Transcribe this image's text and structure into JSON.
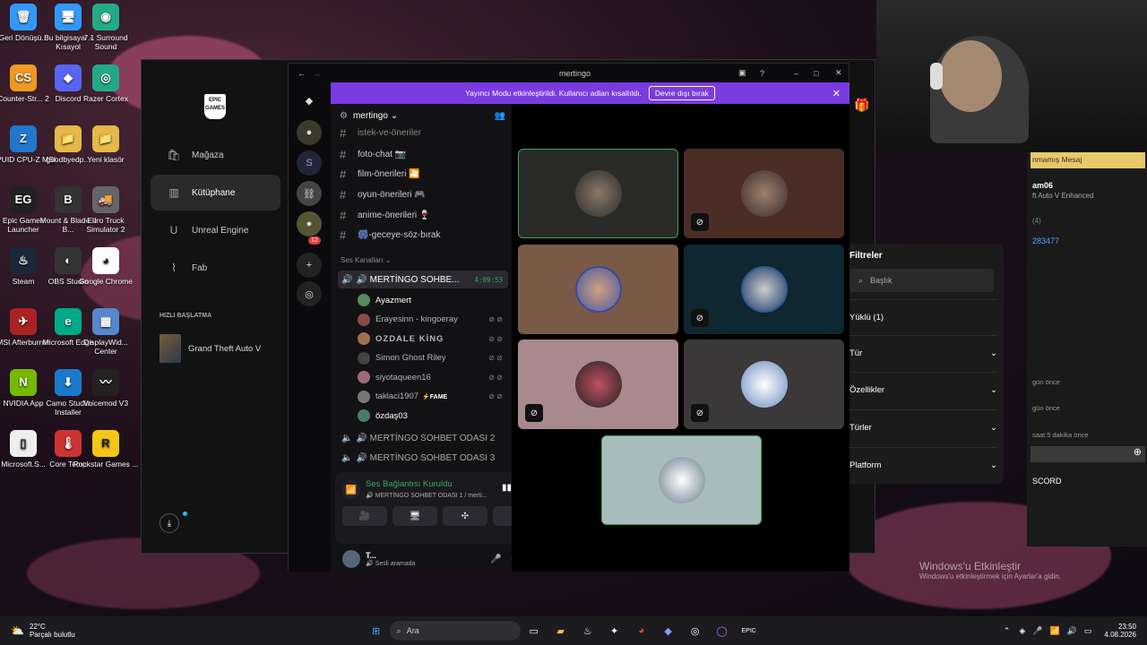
{
  "desktop": {
    "icons": [
      {
        "label": "Geri Dönüşü...",
        "glyph": "🗑"
      },
      {
        "label": "Bu bilgisayar - Kısayol",
        "glyph": "🖥"
      },
      {
        "label": "7.1 Surround Sound",
        "glyph": "◉"
      },
      {
        "label": "Counter-Str... 2",
        "glyph": "CS"
      },
      {
        "label": "Discord",
        "glyph": "◆"
      },
      {
        "label": "Razer Cortex",
        "glyph": "◎"
      },
      {
        "label": "CPUID CPU-Z MSI",
        "glyph": "Z"
      },
      {
        "label": "goodbyedp...",
        "glyph": "📁"
      },
      {
        "label": "Yeni klasör",
        "glyph": "📁"
      },
      {
        "label": "Epic Games Launcher",
        "glyph": "EG"
      },
      {
        "label": "Mount & Blade II B...",
        "glyph": "B"
      },
      {
        "label": "Euro Truck Simulator 2",
        "glyph": "🚚"
      },
      {
        "label": "Steam",
        "glyph": "♨"
      },
      {
        "label": "OBS Studio",
        "glyph": "◐"
      },
      {
        "label": "Google Chrome",
        "glyph": "◕"
      },
      {
        "label": "MSI Afterburner",
        "glyph": "✈"
      },
      {
        "label": "Microsoft Edge",
        "glyph": "e"
      },
      {
        "label": "DisplayWid... Center",
        "glyph": "▦"
      },
      {
        "label": "NVIDIA App",
        "glyph": "N"
      },
      {
        "label": "Camo Studio Installer",
        "glyph": "⬇"
      },
      {
        "label": "Voicemod V3",
        "glyph": "〰"
      },
      {
        "label": "Microsoft.S...",
        "glyph": "▯"
      },
      {
        "label": "Core Temp",
        "glyph": "🌡"
      },
      {
        "label": "Rockstar Games ...",
        "glyph": "R"
      }
    ],
    "watermark_title": "Windows'u Etkinleştir",
    "watermark_sub": "Windows'u etkinleştirmek için Ayarlar'a gidin."
  },
  "epic": {
    "logo": "EPIC GAMES",
    "nav": [
      {
        "label": "Mağaza",
        "glyph": "🛍"
      },
      {
        "label": "Kütüphane",
        "glyph": "▥"
      },
      {
        "label": "Unreal Engine",
        "glyph": "U"
      },
      {
        "label": "Fab",
        "glyph": "⌇"
      }
    ],
    "quick_title": "HIZLI BAŞLATMA",
    "quick_game": "Grand Theft Auto V",
    "filters_title": "Filtreler",
    "search_placeholder": "Başlık",
    "installed": "Yüklü (1)",
    "filter_rows": [
      "Tür",
      "Özellikler",
      "Türler",
      "Platform"
    ]
  },
  "discord": {
    "title": "mertingo",
    "banner_text": "Yayıncı Modu etkinleştirildi. Kullanıcı adları kısaltıldı.",
    "banner_button": "Devre dışı bırak",
    "server_name": "mertingo",
    "server_badge": "12",
    "text_channels": [
      "istek-ve-öneriler",
      "foto-chat 📷",
      "film-önerileri 🎦",
      "oyun-önerileri 🎮",
      "anime-önerileri 🍷",
      "🎆-geceye-söz-bırak"
    ],
    "voice_category": "Ses Kanalları",
    "voice_channel": "🔊 MERTİNGO SOHBE...",
    "voice_time": "4:09:53",
    "voice_users": [
      {
        "name": "Ayazmert",
        "color": "#5a8a5a"
      },
      {
        "name": "Erayesinn - kingoeray",
        "color": "#8a4a4a"
      },
      {
        "name": "OZDALE KİNG",
        "color": "#a07050"
      },
      {
        "name": "Simon Ghost Riley",
        "color": "#444"
      },
      {
        "name": "siyotaqueen16",
        "color": "#9a6a7a"
      },
      {
        "name": "taklaci1907",
        "color": "#777"
      },
      {
        "name": "özdaş03",
        "color": "#4a7a6a"
      }
    ],
    "fame_badge": "⚡FAME",
    "other_voice": [
      "🔊 MERTİNGO SOHBET ODASI 2",
      "🔊 MERTİNGO SOHBET ODASI 3"
    ],
    "connection_status": "Ses Bağlantısı Kuruldu",
    "connection_channel": "🔊 MERTİNGO SOHBET ODASI 1 / merti...",
    "user_name": "T...",
    "user_status": "🔊 Sesli aramada"
  },
  "right_panel": {
    "line1": "nmamış Mesaj",
    "line2": "am06",
    "line3": "ft Auto V Enhanced",
    "line4": "(4)",
    "line5": "283477",
    "time1": "gün önce",
    "time2": "gün önce",
    "time3": "saat 5 dakika önce",
    "footer": "SCORD"
  },
  "taskbar": {
    "weather_temp": "22°C",
    "weather_desc": "Parçalı bulutlu",
    "search_placeholder": "Ara",
    "time": "23:50",
    "date": "4.08.2026"
  },
  "colors": {
    "accent": "#7a3be0",
    "speaking": "#3ba55d",
    "epic_bg": "#121212"
  }
}
